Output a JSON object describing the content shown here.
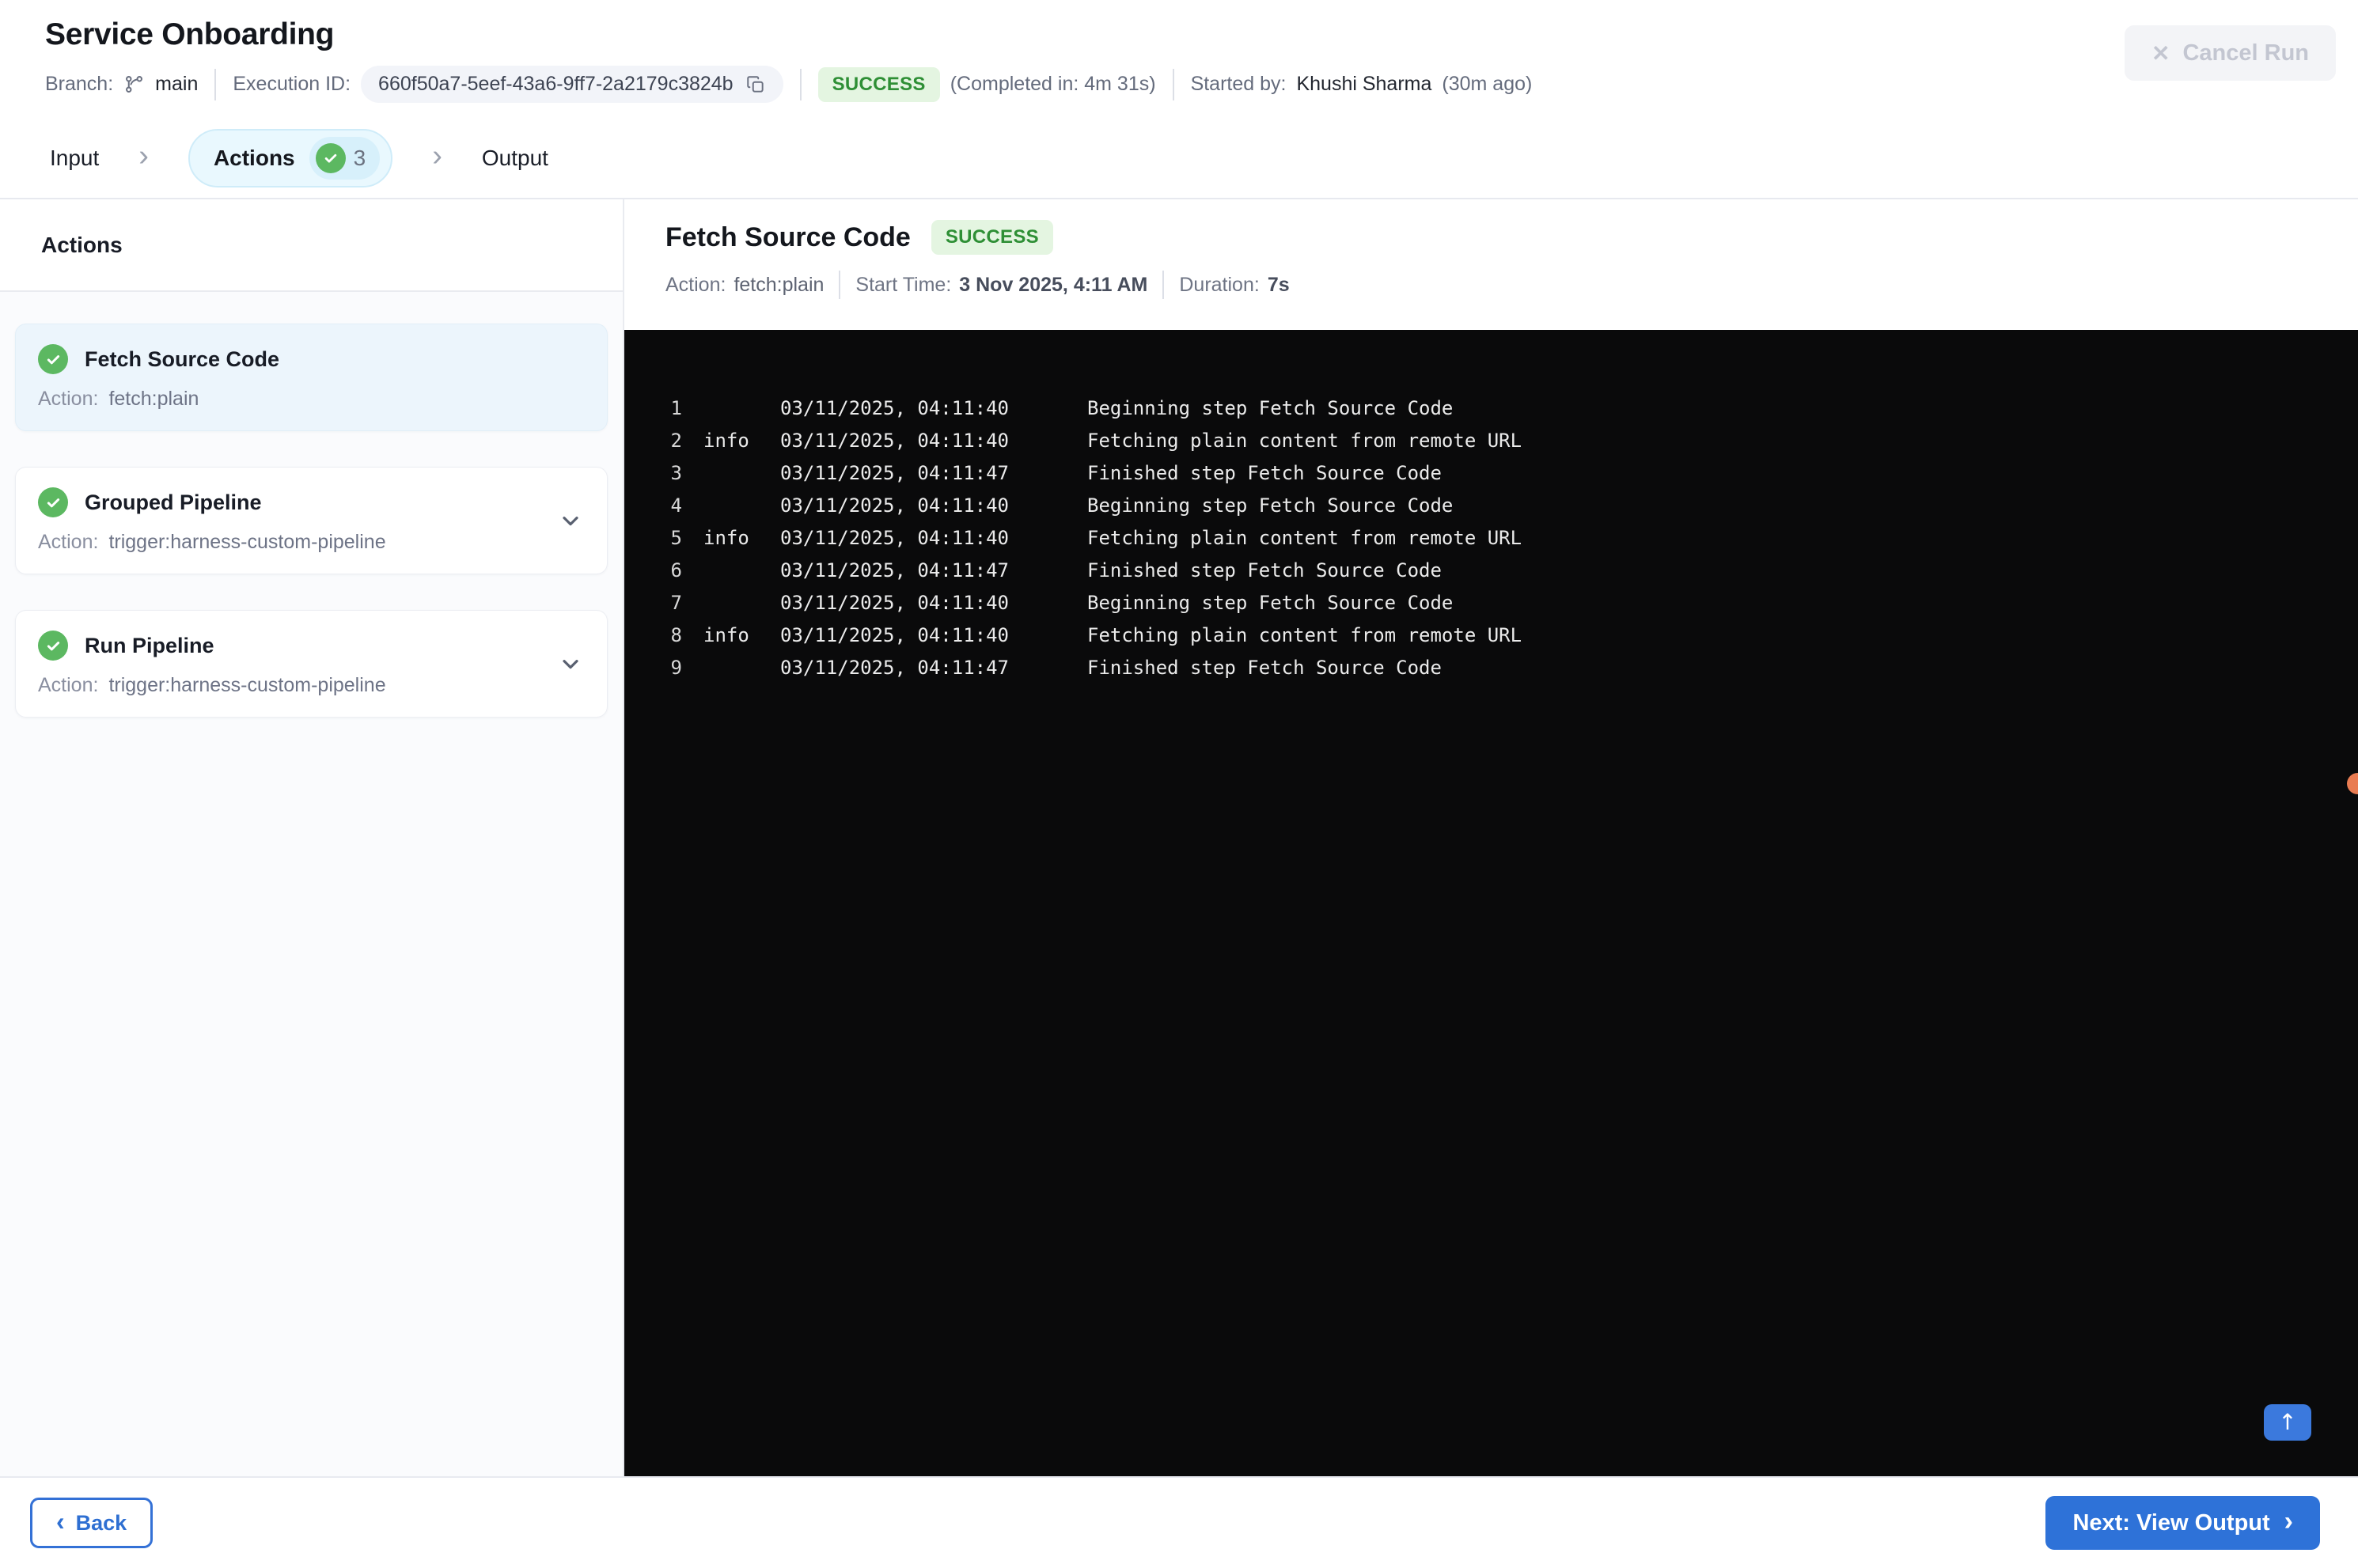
{
  "header": {
    "title": "Service Onboarding",
    "branch_label": "Branch:",
    "branch_value": "main",
    "execution_id_label": "Execution ID:",
    "execution_id": "660f50a7-5eef-43a6-9ff7-2a2179c3824b",
    "status_badge": "SUCCESS",
    "completed_in": "(Completed in: 4m 31s)",
    "started_by_label": "Started by:",
    "started_by_name": "Khushi Sharma",
    "started_by_ago": "(30m ago)",
    "cancel_button": "Cancel Run"
  },
  "stepper": {
    "steps": [
      {
        "label": "Input"
      },
      {
        "label": "Actions",
        "count": "3",
        "active": true
      },
      {
        "label": "Output"
      }
    ]
  },
  "sidebar": {
    "heading": "Actions",
    "action_label": "Action:",
    "items": [
      {
        "title": "Fetch Source Code",
        "action": "fetch:plain",
        "status": "success",
        "selected": true,
        "expandable": false
      },
      {
        "title": "Grouped Pipeline",
        "action": "trigger:harness-custom-pipeline",
        "status": "success",
        "selected": false,
        "expandable": true
      },
      {
        "title": "Run Pipeline",
        "action": "trigger:harness-custom-pipeline",
        "status": "success",
        "selected": false,
        "expandable": true
      }
    ]
  },
  "detail": {
    "title": "Fetch Source Code",
    "status_badge": "SUCCESS",
    "meta": [
      {
        "label": "Action:",
        "value": "fetch:plain"
      },
      {
        "label": "Start Time:",
        "value": "3 Nov 2025, 4:11 AM"
      },
      {
        "label": "Duration:",
        "value": "7s"
      }
    ]
  },
  "log": {
    "lines": [
      {
        "num": "1",
        "level": "",
        "time": "03/11/2025, 04:11:40",
        "message": "Beginning step Fetch Source Code"
      },
      {
        "num": "2",
        "level": "info",
        "time": "03/11/2025, 04:11:40",
        "message": "Fetching plain content from remote URL"
      },
      {
        "num": "3",
        "level": "",
        "time": "03/11/2025, 04:11:47",
        "message": "Finished step Fetch Source Code"
      },
      {
        "num": "4",
        "level": "",
        "time": "03/11/2025, 04:11:40",
        "message": "Beginning step Fetch Source Code"
      },
      {
        "num": "5",
        "level": "info",
        "time": "03/11/2025, 04:11:40",
        "message": "Fetching plain content from remote URL"
      },
      {
        "num": "6",
        "level": "",
        "time": "03/11/2025, 04:11:47",
        "message": "Finished step Fetch Source Code"
      },
      {
        "num": "7",
        "level": "",
        "time": "03/11/2025, 04:11:40",
        "message": "Beginning step Fetch Source Code"
      },
      {
        "num": "8",
        "level": "info",
        "time": "03/11/2025, 04:11:40",
        "message": "Fetching plain content from remote URL"
      },
      {
        "num": "9",
        "level": "",
        "time": "03/11/2025, 04:11:47",
        "message": "Finished step Fetch Source Code"
      }
    ]
  },
  "footer": {
    "back_label": "Back",
    "next_label": "Next: View Output"
  },
  "colors": {
    "accent_blue": "#2e72d8",
    "success_text": "#2e8f35",
    "success_bg": "#e4f5e1",
    "check_green": "#5cb861",
    "console_bg": "#0a0a0b",
    "selected_card_bg": "#ecf5fc",
    "active_tab_bg": "#e9f8fe",
    "orange_dot": "#e97c52"
  }
}
